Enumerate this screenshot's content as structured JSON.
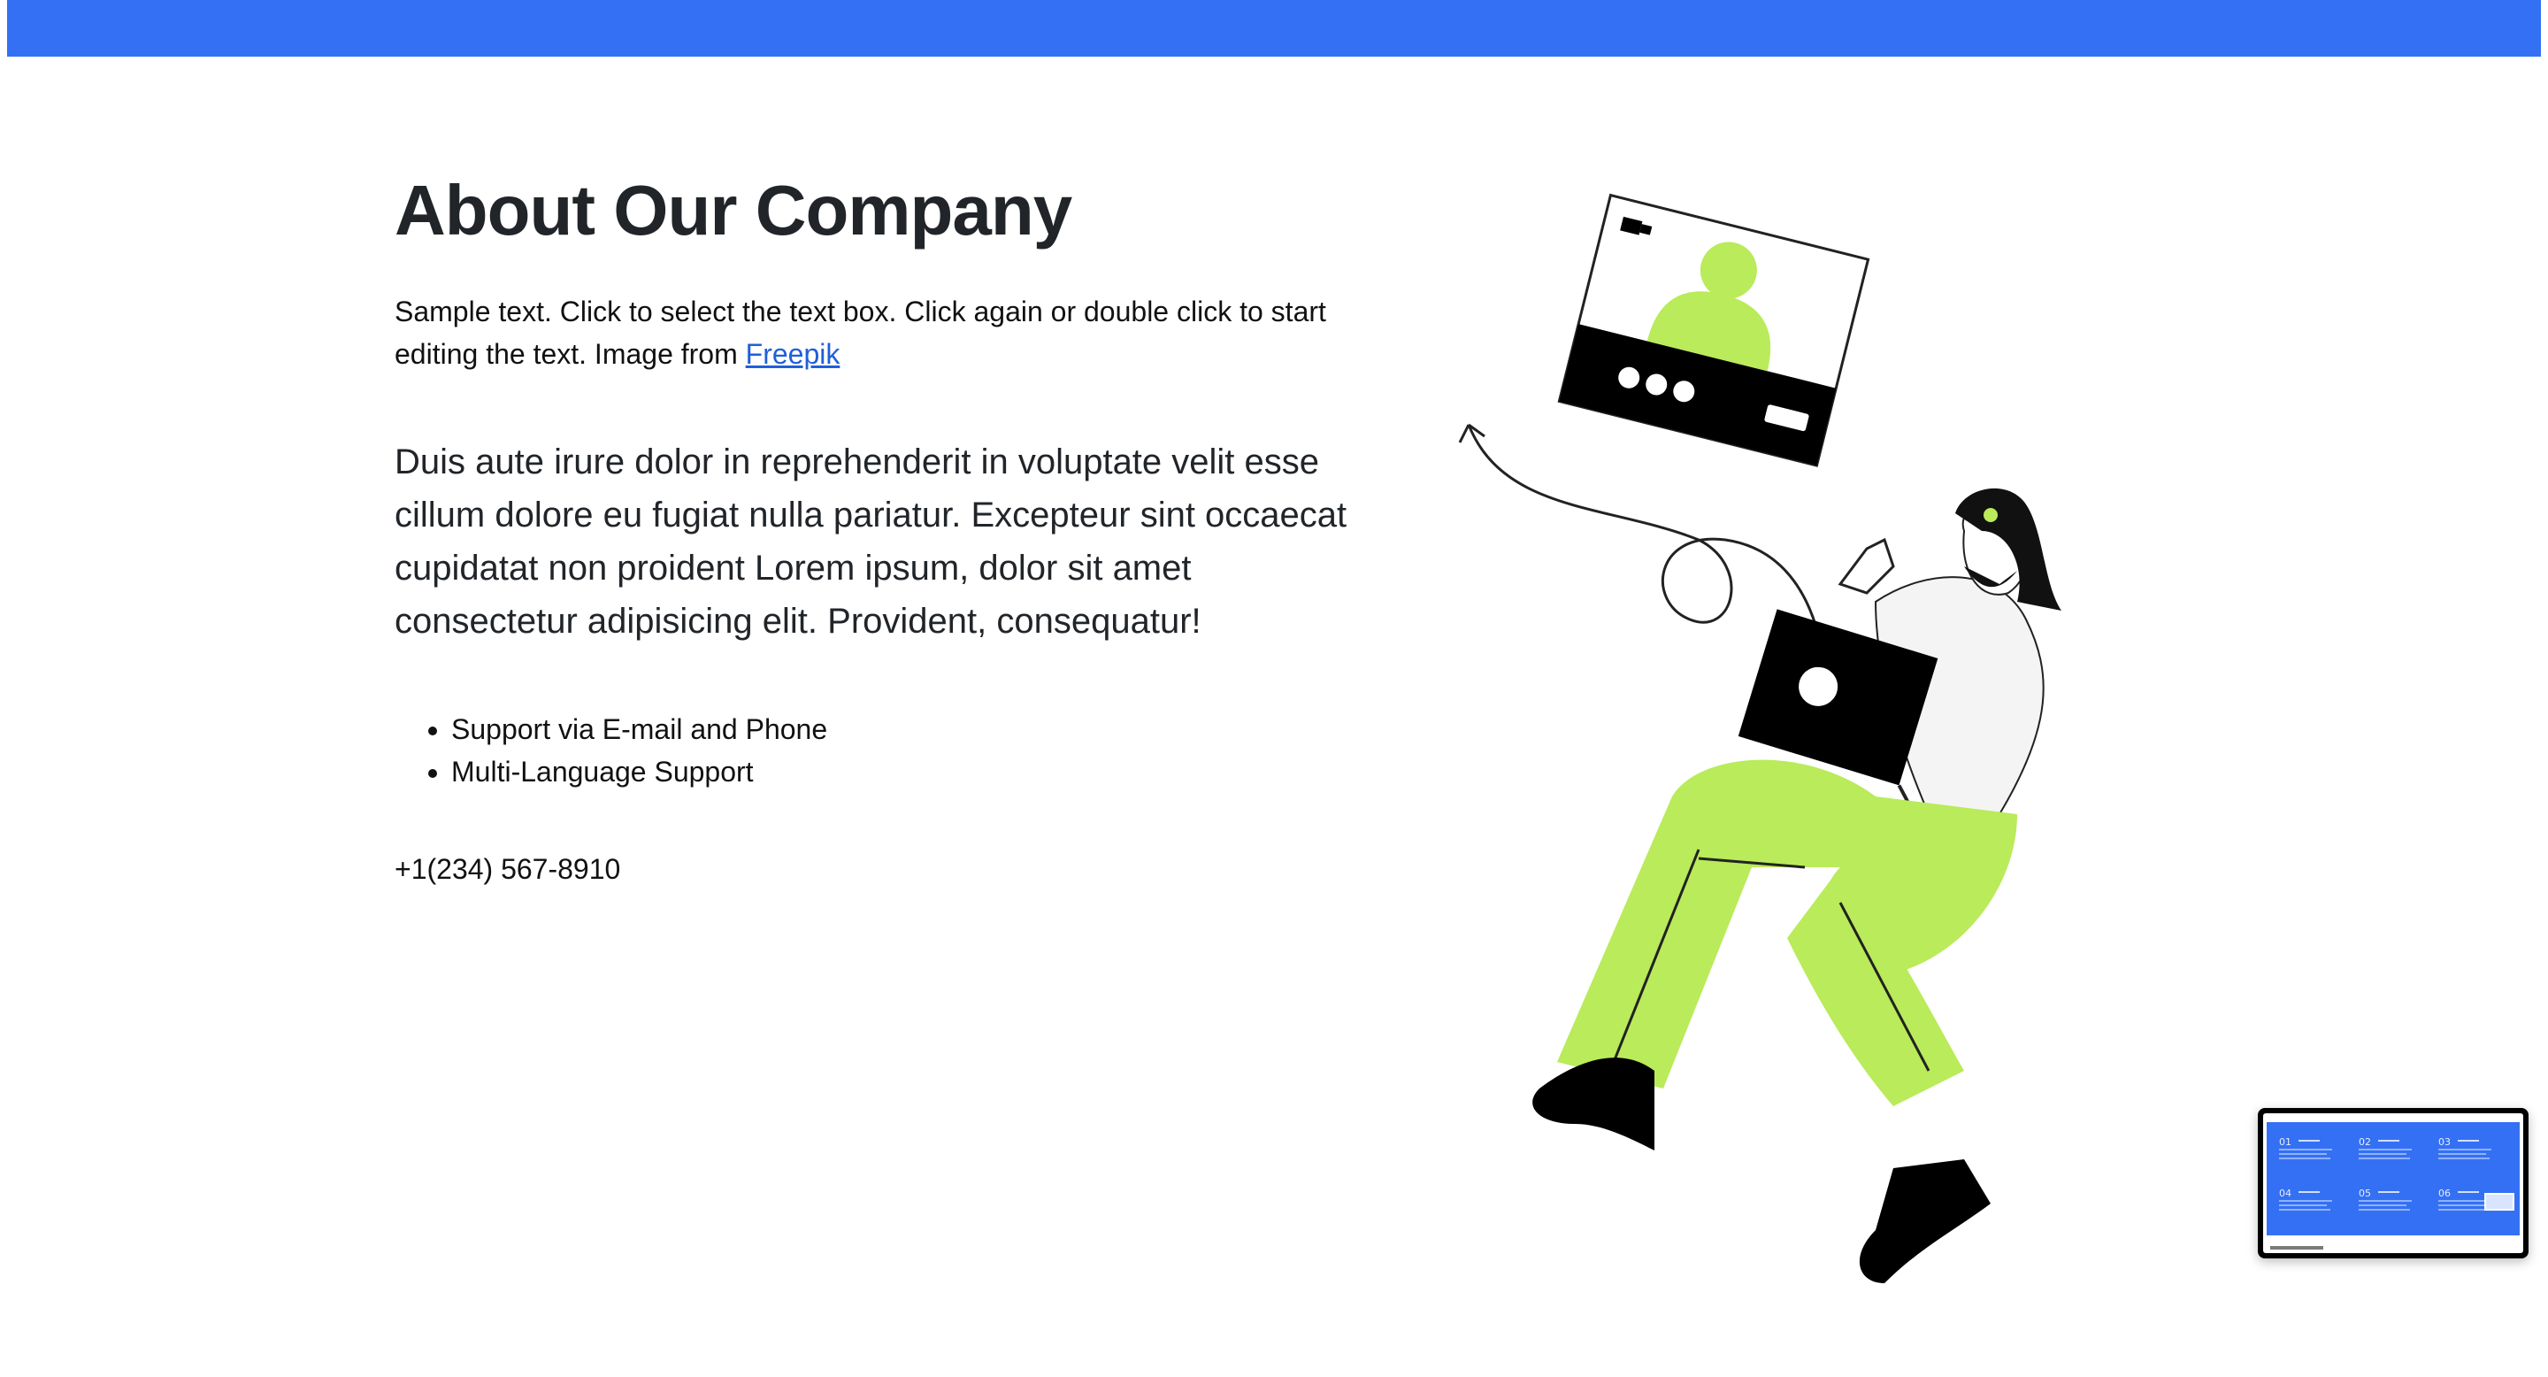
{
  "header": {
    "bar_color": "#3470f4"
  },
  "about": {
    "title": "About Our Company",
    "sample_text": "Sample text. Click to select the text box. Click again or double click to start editing the text. Image from ",
    "link_label": "Freepik",
    "lead": "Duis aute irure dolor in reprehenderit in voluptate velit esse cillum dolore eu fugiat nulla pariatur. Excepteur sint occaecat cupidatat non proident Lorem ipsum, dolor sit amet consectetur adipisicing elit. Provident, consequatur!",
    "features": [
      "Support via E-mail and Phone",
      "Multi-Language Support"
    ],
    "phone": "+1(234) 567-8910"
  },
  "illustration": {
    "icon": "person-with-laptop-illustration",
    "accent_color": "#b9eb5a"
  },
  "preview": {
    "icon": "page-preview-thumbnail",
    "numbers": [
      "01",
      "02",
      "03",
      "04",
      "05",
      "06"
    ]
  }
}
